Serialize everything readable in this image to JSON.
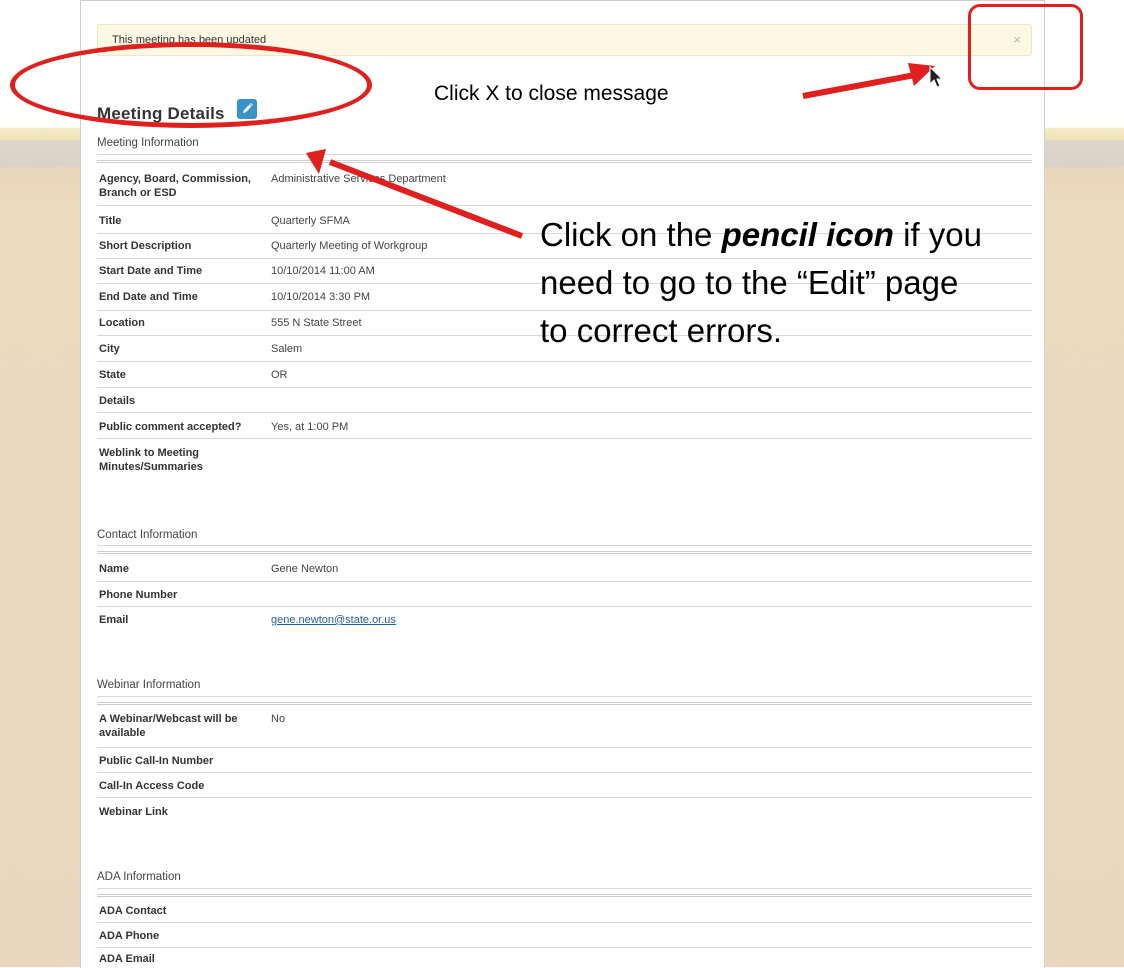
{
  "alert": {
    "message": "This meeting has been updated",
    "close": "×"
  },
  "header": {
    "title": "Meeting Details"
  },
  "annotations": {
    "close_hint": "Click X to close message",
    "pencil_hint_pre": "Click on the ",
    "pencil_hint_em": "pencil icon",
    "pencil_hint_post": " if you",
    "pencil_hint_line2": "need to go to the “Edit” page",
    "pencil_hint_line3": "to correct errors."
  },
  "meeting": {
    "section": "Meeting Information",
    "rows": [
      {
        "label": "Agency, Board, Commission, Branch or ESD",
        "value": "Administrative Services Department"
      },
      {
        "label": "Title",
        "value": "Quarterly SFMA"
      },
      {
        "label": "Short Description",
        "value": "Quarterly Meeting of Workgroup"
      },
      {
        "label": "Start Date and Time",
        "value": "10/10/2014 11:00 AM"
      },
      {
        "label": "End Date and Time",
        "value": "10/10/2014 3:30 PM"
      },
      {
        "label": "Location",
        "value": "555 N State Street"
      },
      {
        "label": "City",
        "value": "Salem"
      },
      {
        "label": "State",
        "value": "OR"
      },
      {
        "label": "Details",
        "value": ""
      },
      {
        "label": "Public comment accepted?",
        "value": "Yes, at 1:00 PM"
      },
      {
        "label": "Weblink to Meeting Minutes/Summaries",
        "value": ""
      }
    ]
  },
  "contact": {
    "section": "Contact Information",
    "rows": [
      {
        "label": "Name",
        "value": "Gene Newton"
      },
      {
        "label": "Phone Number",
        "value": ""
      },
      {
        "label": "Email",
        "value": "gene.newton@state.or.us"
      }
    ]
  },
  "webinar": {
    "section": "Webinar Information",
    "rows": [
      {
        "label": "A Webinar/Webcast will be available",
        "value": "No"
      },
      {
        "label": "Public Call-In Number",
        "value": ""
      },
      {
        "label": "Call-In Access Code",
        "value": ""
      },
      {
        "label": "Webinar Link",
        "value": ""
      }
    ]
  },
  "ada": {
    "section": "ADA Information",
    "rows": [
      {
        "label": "ADA Contact",
        "value": ""
      },
      {
        "label": "ADA Phone",
        "value": ""
      },
      {
        "label": "ADA Email",
        "value": ""
      }
    ]
  },
  "colors": {
    "annotation_red": "#e0201e",
    "pencil_blue": "#3a93c7",
    "alert_bg": "#fcf8e3"
  }
}
